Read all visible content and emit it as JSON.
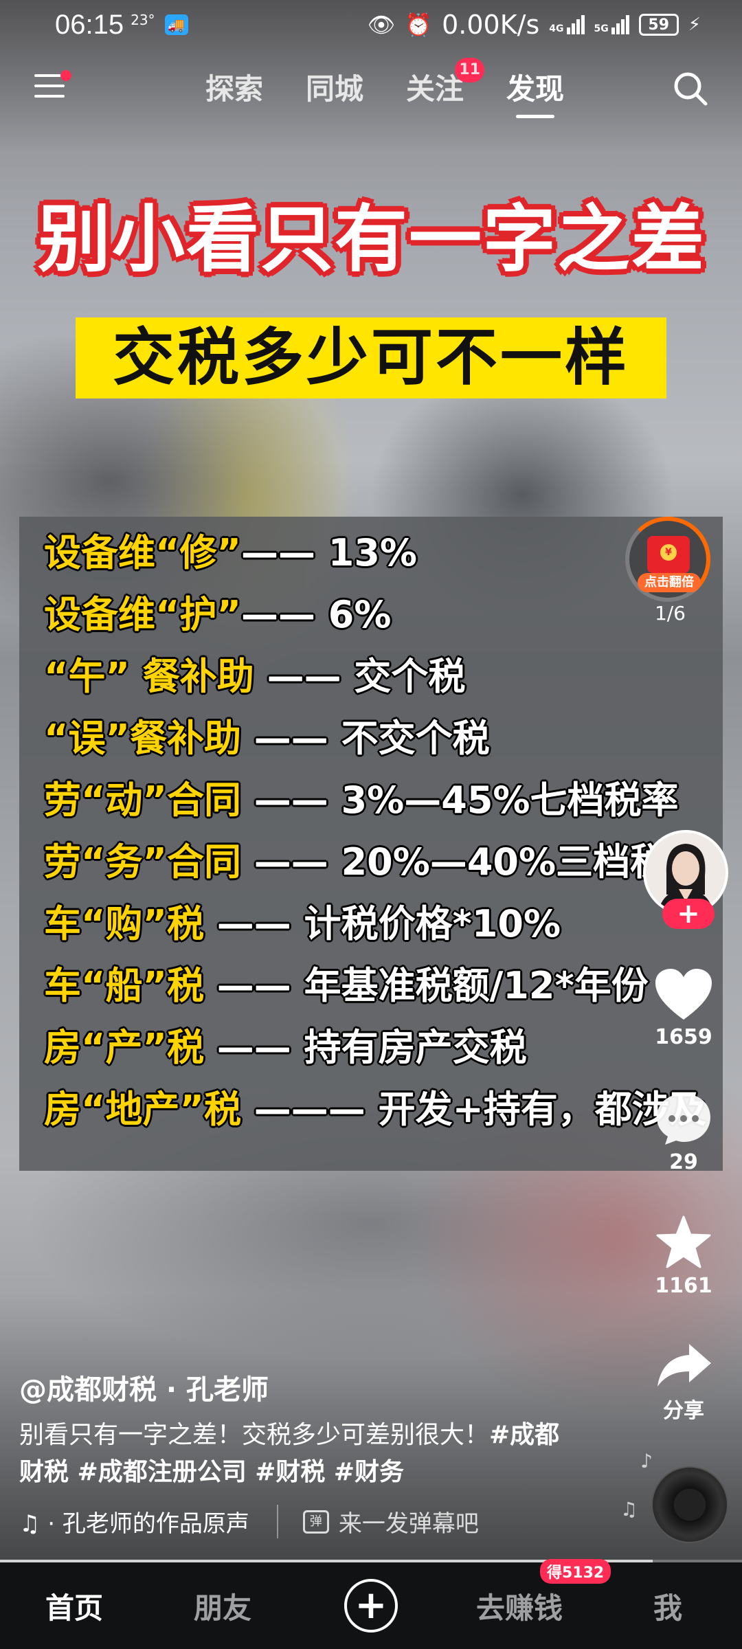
{
  "status_bar": {
    "time": "06:15",
    "temp": "23°",
    "network_speed": "0.00K/s",
    "sig1": "4G",
    "sig2": "5G",
    "battery": "59"
  },
  "top_nav": {
    "tabs": [
      {
        "label": "探索"
      },
      {
        "label": "同城"
      },
      {
        "label": "关注",
        "badge": "11"
      },
      {
        "label": "发现",
        "active": true
      }
    ]
  },
  "video": {
    "title_line1": "别小看只有一字之差",
    "title_line2": "交税多少可不一样",
    "rows": [
      {
        "key": "设备维“修”",
        "value": "—— 13%"
      },
      {
        "key": "设备维“护”",
        "value": "—— 6%"
      },
      {
        "key": "“午” 餐补助",
        "value": " —— 交个税"
      },
      {
        "key": "“误”餐补助",
        "value": " —— 不交个税"
      },
      {
        "key": "劳“动”合同",
        "value": " —— 3%—45%七档税率"
      },
      {
        "key": "劳“务”合同",
        "value": " —— 20%—40%三档税率"
      },
      {
        "key": "车“购”税",
        "value": " —— 计税价格*10%"
      },
      {
        "key": "车“船”税",
        "value": " —— 年基准税额/12*年份"
      },
      {
        "key": "房“产”税",
        "value": " —— 持有房产交税"
      },
      {
        "key": "房“地产”税",
        "value": " ——— 开发+持有，都涉及"
      }
    ]
  },
  "right_rail": {
    "redpacket_label": "点击翻倍",
    "page_counter": "1/6",
    "likes": "1659",
    "comments": "29",
    "favorites": "1161",
    "share_label": "分享",
    "follow_plus": "+"
  },
  "description": {
    "author": "@成都财税 · 孔老师",
    "text": "别看只有一字之差！交税多少可差别很大！",
    "tags": "#成都财税 #成都注册公司 #财税 #财务",
    "music": "♫ · 孔老师的作品原声",
    "danmu_placeholder": "来一发弹幕吧"
  },
  "progress": 0.88,
  "bottom_nav": {
    "items": [
      {
        "label": "首页",
        "active": true
      },
      {
        "label": "朋友"
      },
      {
        "label": "+"
      },
      {
        "label": "去赚钱",
        "badge": "得5132"
      },
      {
        "label": "我"
      }
    ]
  }
}
